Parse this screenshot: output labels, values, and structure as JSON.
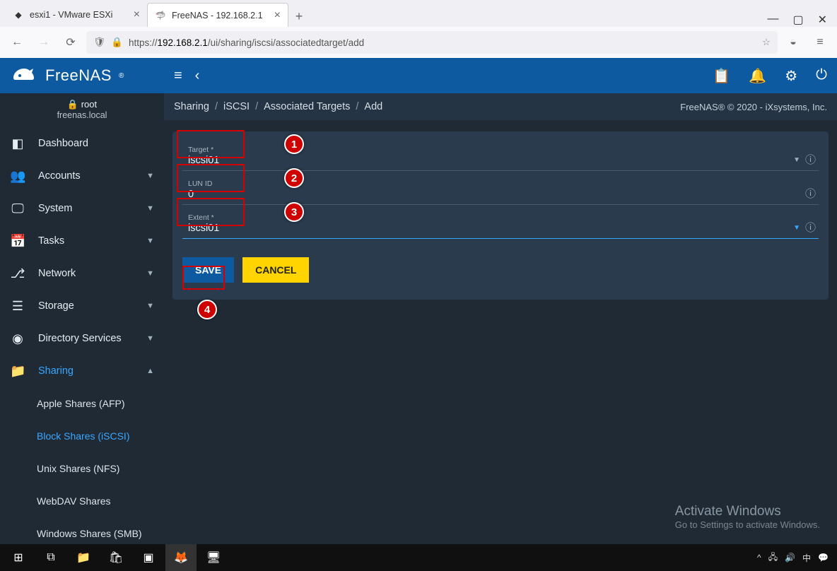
{
  "browser": {
    "tabs": [
      {
        "title": "esxi1 - VMware ESXi",
        "active": false
      },
      {
        "title": "FreeNAS - 192.168.2.1",
        "active": true
      }
    ],
    "url_prefix": "https://",
    "url_host": "192.168.2.1",
    "url_path": "/ui/sharing/iscsi/associatedtarget/add"
  },
  "brand": "FreeNAS",
  "user": {
    "name": "root",
    "host": "freenas.local"
  },
  "sidebar": {
    "items": [
      {
        "icon": "dashboard",
        "label": "Dashboard",
        "expand": false
      },
      {
        "icon": "accounts",
        "label": "Accounts",
        "expand": true
      },
      {
        "icon": "system",
        "label": "System",
        "expand": true
      },
      {
        "icon": "tasks",
        "label": "Tasks",
        "expand": true
      },
      {
        "icon": "network",
        "label": "Network",
        "expand": true
      },
      {
        "icon": "storage",
        "label": "Storage",
        "expand": true
      },
      {
        "icon": "dirsvc",
        "label": "Directory Services",
        "expand": true
      },
      {
        "icon": "sharing",
        "label": "Sharing",
        "expand": true,
        "selected": true
      }
    ],
    "sharing_children": [
      {
        "label": "Apple Shares (AFP)"
      },
      {
        "label": "Block Shares (iSCSI)",
        "selected": true
      },
      {
        "label": "Unix Shares (NFS)"
      },
      {
        "label": "WebDAV Shares"
      },
      {
        "label": "Windows Shares (SMB)"
      }
    ]
  },
  "breadcrumb": [
    "Sharing",
    "iSCSI",
    "Associated Targets",
    "Add"
  ],
  "copyright": "FreeNAS® © 2020 - iXsystems, Inc.",
  "form": {
    "target": {
      "label": "Target *",
      "value": "iscsi01"
    },
    "lunid": {
      "label": "LUN ID",
      "value": "0"
    },
    "extent": {
      "label": "Extent *",
      "value": "iscsi01"
    },
    "save": "SAVE",
    "cancel": "CANCEL"
  },
  "annotations": {
    "n1": "1",
    "n2": "2",
    "n3": "3",
    "n4": "4"
  },
  "watermark": {
    "title": "Activate Windows",
    "sub": "Go to Settings to activate Windows."
  }
}
